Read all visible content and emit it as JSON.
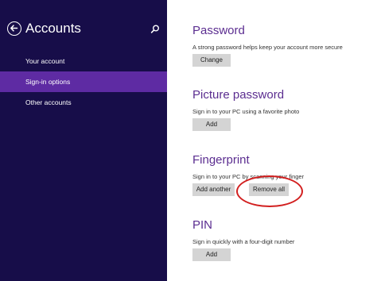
{
  "sidebar": {
    "title": "Accounts",
    "back_icon": "back-arrow-icon",
    "search_icon": "search-icon",
    "items": [
      {
        "label": "Your account",
        "active": false
      },
      {
        "label": "Sign-in options",
        "active": true
      },
      {
        "label": "Other accounts",
        "active": false
      }
    ]
  },
  "main": {
    "sections": [
      {
        "title": "Password",
        "description": "A strong password helps keep your account more secure",
        "buttons": [
          "Change"
        ]
      },
      {
        "title": "Picture password",
        "description": "Sign in to your PC using a favorite photo",
        "buttons": [
          "Add"
        ]
      },
      {
        "title": "Fingerprint",
        "description": "Sign in to your PC by scanning your finger",
        "buttons": [
          "Add another",
          "Remove all"
        ]
      },
      {
        "title": "PIN",
        "description": "Sign in quickly with a four-digit number",
        "buttons": [
          "Add"
        ]
      }
    ]
  },
  "colors": {
    "sidebar_background": "#170d49",
    "sidebar_active": "#5e2ba3",
    "heading_purple": "#5b2d90",
    "button_gray": "#d4d4d4",
    "annotation_red": "#d21f1f"
  }
}
